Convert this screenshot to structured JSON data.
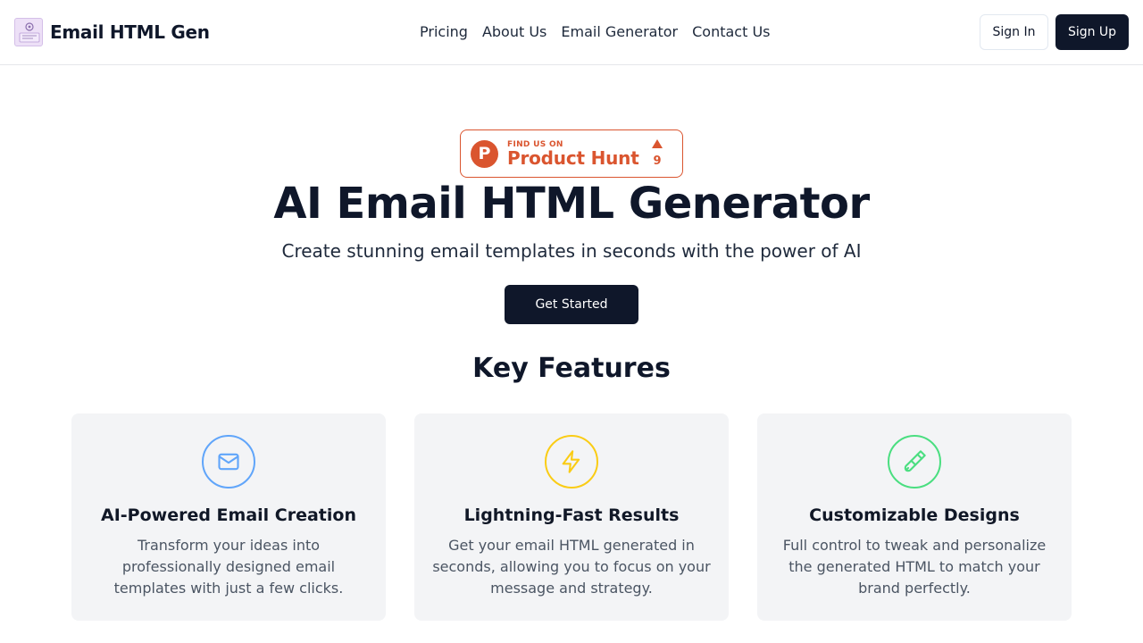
{
  "header": {
    "brand_name": "Email HTML Gen",
    "nav": [
      "Pricing",
      "About Us",
      "Email Generator",
      "Contact Us"
    ],
    "sign_in": "Sign In",
    "sign_up": "Sign Up"
  },
  "product_hunt": {
    "find_us": "FIND US ON",
    "name": "Product Hunt",
    "logo_letter": "P",
    "upvotes": "9",
    "color": "#da552f"
  },
  "hero": {
    "title": "AI Email HTML Generator",
    "subtitle": "Create stunning email templates in seconds with the power of AI",
    "cta": "Get Started"
  },
  "features": {
    "title": "Key Features",
    "items": [
      {
        "icon": "mail-icon",
        "color": "#60a5fa",
        "title": "AI-Powered Email Creation",
        "description": "Transform your ideas into professionally designed email templates with just a few clicks."
      },
      {
        "icon": "lightning-icon",
        "color": "#facc15",
        "title": "Lightning-Fast Results",
        "description": "Get your email HTML generated in seconds, allowing you to focus on your message and strategy."
      },
      {
        "icon": "paintbrush-icon",
        "color": "#4ade80",
        "title": "Customizable Designs",
        "description": "Full control to tweak and personalize the generated HTML to match your brand perfectly."
      }
    ]
  }
}
